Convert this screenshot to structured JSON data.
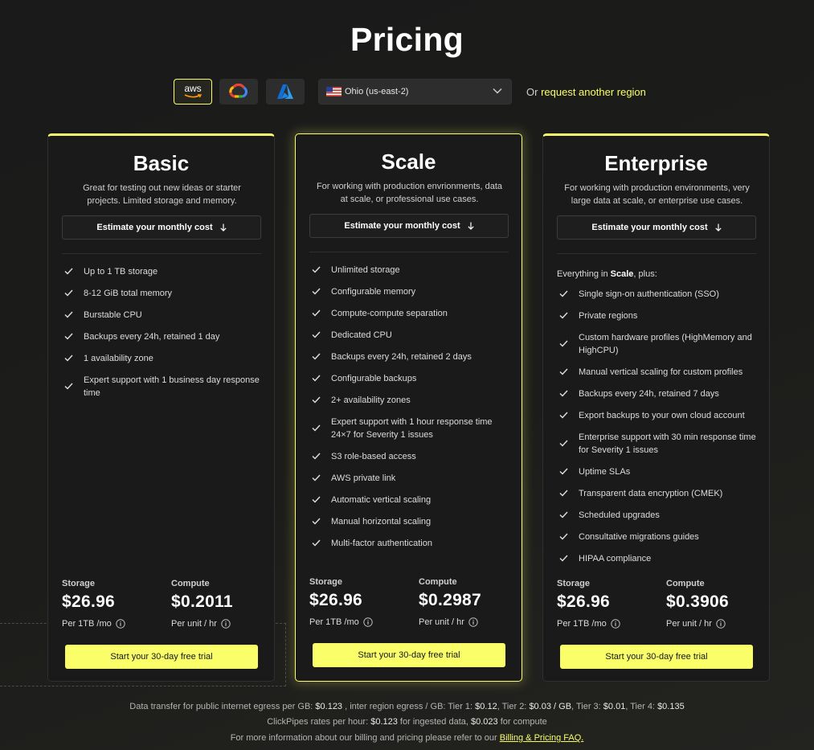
{
  "page": {
    "title": "Pricing"
  },
  "cloud": {
    "aws_label": "aws",
    "selected_provider": "aws",
    "providers": [
      "aws-icon",
      "google-cloud-icon",
      "azure-icon"
    ],
    "region": "Ohio (us-east-2)",
    "request_prefix": "Or",
    "request_link": "request another region"
  },
  "colors": {
    "accent": "#faff69",
    "background": "#1b1b1b",
    "card": "#1a1a1a"
  },
  "plans": [
    {
      "name": "Basic",
      "description": "Great for testing out new ideas or starter projects. Limited storage and memory.",
      "estimate_label": "Estimate your monthly cost",
      "features": [
        "Up to 1 TB storage",
        "8-12 GiB total memory",
        "Burstable CPU",
        "Backups every 24h, retained 1 day",
        "1 availability zone",
        "Expert support with 1 business day response time"
      ],
      "storage_label": "Storage",
      "storage_price": "$26.96",
      "storage_unit": "Per 1TB /mo",
      "compute_label": "Compute",
      "compute_price": "$0.2011",
      "compute_unit": "Per unit / hr",
      "cta": "Start your 30-day free trial"
    },
    {
      "name": "Scale",
      "description": "For working with production envrionments, data at scale, or professional use cases.",
      "estimate_label": "Estimate your monthly cost",
      "features": [
        "Unlimited storage",
        "Configurable memory",
        "Compute-compute separation",
        "Dedicated CPU",
        "Backups every 24h, retained 2 days",
        "Configurable backups",
        "2+ availability zones",
        "Expert support with 1 hour response time 24×7 for Severity 1 issues",
        "S3 role-based access",
        "AWS private link",
        "Automatic vertical scaling",
        "Manual horizontal scaling",
        "Multi-factor authentication"
      ],
      "storage_label": "Storage",
      "storage_price": "$26.96",
      "storage_unit": "Per 1TB /mo",
      "compute_label": "Compute",
      "compute_price": "$0.2987",
      "compute_unit": "Per unit / hr",
      "cta": "Start your 30-day free trial"
    },
    {
      "name": "Enterprise",
      "description": "For working with production environments, very large data at scale, or enterprise use cases.",
      "estimate_label": "Estimate your monthly cost",
      "intro_prefix": "Everything in",
      "intro_bold": "Scale",
      "intro_suffix": ", plus:",
      "features": [
        "Single sign-on authentication (SSO)",
        "Private regions",
        "Custom hardware profiles (HighMemory and HighCPU)",
        "Manual vertical scaling for custom profiles",
        "Backups every 24h, retained 7 days",
        "Export backups to your own cloud account",
        "Enterprise support with 30 min response time for Severity 1 issues",
        "Uptime SLAs",
        "Transparent data encryption (CMEK)",
        "Scheduled upgrades",
        "Consultative migrations guides",
        "HIPAA compliance"
      ],
      "storage_label": "Storage",
      "storage_price": "$26.96",
      "storage_unit": "Per 1TB /mo",
      "compute_label": "Compute",
      "compute_price": "$0.3906",
      "compute_unit": "Per unit / hr",
      "cta": "Start your 30-day free trial"
    }
  ],
  "footer": {
    "egress_a": "Data transfer for public internet egress per GB:",
    "egress_a_val": "$0.123",
    "egress_b": ", inter region egress / GB: Tier 1:",
    "tier1": "$0.12",
    "tier2_label": ", Tier 2:",
    "tier2": "$0.03 / GB",
    "tier3_label": ", Tier 3:",
    "tier3": "$0.01",
    "tier4_label": ", Tier 4:",
    "tier4": "$0.135",
    "clickpipes_a": "ClickPipes rates per hour:",
    "clickpipes_ingest": "$0.123",
    "clickpipes_b": "for ingested data,",
    "clickpipes_compute": "$0.023",
    "clickpipes_c": "for compute",
    "faq_prefix": "For more information about our billing and pricing please refer to our",
    "faq_link": "Billing & Pricing FAQ."
  }
}
